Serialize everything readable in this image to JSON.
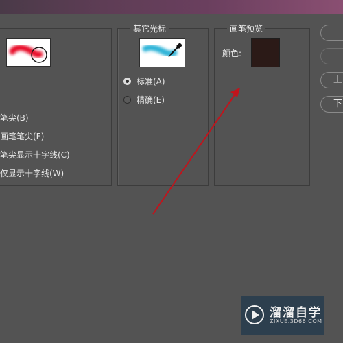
{
  "window": {
    "title": ""
  },
  "painting_cursors": {
    "options": [
      {
        "label": "笔尖(B)"
      },
      {
        "label": "画笔笔尖(F)"
      },
      {
        "label": "笔尖显示十字线(C)"
      },
      {
        "label": "仅显示十字线(W)"
      }
    ]
  },
  "other_cursors": {
    "title": "其它光标",
    "options": [
      {
        "label": "标准(A)",
        "checked": true
      },
      {
        "label": "精确(E)",
        "checked": false
      }
    ]
  },
  "brush_preview": {
    "title": "画笔预览",
    "color_label": "颜色:",
    "color_value": "#2b1a17"
  },
  "side_buttons": [
    {
      "label": ""
    },
    {
      "label": ""
    },
    {
      "label": "上"
    },
    {
      "label": "下"
    }
  ],
  "watermark": {
    "title": "溜溜自学",
    "url": "ZIXUE.3D66.COM"
  },
  "colors": {
    "background": "#535353",
    "annotation_arrow": "#c0141c",
    "brush_red": "#e8102a",
    "brush_cyan": "#2fb4d8"
  }
}
